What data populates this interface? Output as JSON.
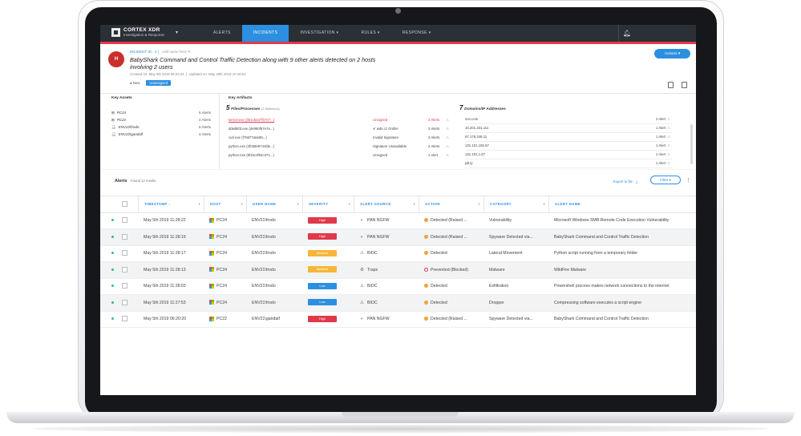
{
  "app": {
    "brand": "CORTEX XDR",
    "brand_sub": "Investigation & Response",
    "nav": [
      "ALERTS",
      "INCIDENTS",
      "INVESTIGATION ▾",
      "RULES ▾",
      "RESPONSE ▾"
    ],
    "active_nav": 1,
    "accent": "#2c8fe0"
  },
  "incident": {
    "avatar_letter": "H",
    "id_label": "INCIDENT ID - 4",
    "alias_placeholder": "Add name here",
    "title": "BabyShark Command and Control Traffic Detection along with 9 other alerts detected on 2 hosts involving 2 users",
    "created": "Created on: May 5th 2019 06:23:34",
    "updated": "Updated on: May 30th 2019 10:18:04",
    "tag_new": "● New",
    "status": "Unassigned",
    "actions_label": "Actions ▾"
  },
  "key_assets": {
    "title": "Key Assets",
    "rows": [
      {
        "icon": "windows-host-icon",
        "name": "PC24",
        "count": "6 Alerts"
      },
      {
        "icon": "windows-host-icon",
        "name": "PC22",
        "count": "4 Alerts"
      },
      {
        "icon": "user-icon",
        "name": "ENV22\\frodo",
        "count": "6 Alerts"
      },
      {
        "icon": "user-icon",
        "name": "ENV22\\gandalf",
        "count": "4 Alerts"
      }
    ]
  },
  "key_artifacts": {
    "title": "Key Artifacts",
    "files_count": "5",
    "files_label": "Files/Processes",
    "files_note": "(2 Malicious)",
    "files": [
      {
        "name": "kernel.exe (0b1c6a47fb707...)",
        "signer": "Unsigned",
        "alerts": "2 Alerts",
        "malicious": true
      },
      {
        "name": "ddwbkfd.exe (de950f67e7e...)",
        "signer": "✔ wds.cz GmbH",
        "alerts": "3 Alerts",
        "malicious": false
      },
      {
        "name": "curl.exe (f78d77a6e85...)",
        "signer": "Invalid Signature",
        "alerts": "2 Alerts",
        "malicious": false
      },
      {
        "name": "python.exe (4f038e9741fde...)",
        "signer": "Signature Unavailable",
        "alerts": "2 Alerts",
        "malicious": false
      },
      {
        "name": "python.exe (9f1bc3f04c371...)",
        "signer": "Unsigned",
        "alerts": "1 Alert",
        "malicious": false
      }
    ],
    "domains_count": "7",
    "domains_label": "Domains/IP Addresses",
    "domains": [
      {
        "name": "cnn.com",
        "alerts": "2 Alert"
      },
      {
        "name": "10.201.231.111",
        "alerts": "1 Alert"
      },
      {
        "name": "67.179.248.11",
        "alerts": "1 Alert"
      },
      {
        "name": "131.101.192.67",
        "alerts": "1 Alert"
      },
      {
        "name": "131.101.1.67",
        "alerts": "1 Alert"
      },
      {
        "name": "jslt.ly",
        "alerts": "1 Alert"
      }
    ]
  },
  "alerts": {
    "title": "Alerts",
    "found": "Found 12 results",
    "export_label": "Export to file",
    "filter_label": "Filter ▾",
    "columns": [
      "TIMESTAMP ↓",
      "HOST",
      "USER NAME",
      "SEVERITY",
      "ALERT SOURCE",
      "ACTION",
      "CATEGORY",
      "ALERT NAME"
    ],
    "rows": [
      {
        "ts": "May 5th 2019 11:28:22",
        "host": "PC24",
        "user": "ENV21\\frodo",
        "sev": "High",
        "src": "PAN NGFW",
        "src_icon": "firewall-icon",
        "action": "Detected (Raised ...",
        "action_icon": "detected-icon",
        "cat": "Vulnerability",
        "name": "Microsoft Windows SMB Remote Code Execution Vulnerability"
      },
      {
        "ts": "May 5th 2019 11:28:19",
        "host": "PC24",
        "user": "ENV21\\frodo",
        "sev": "High",
        "src": "PAN NGFW",
        "src_icon": "firewall-icon",
        "action": "Detected (Raised ...",
        "action_icon": "detected-icon",
        "cat": "Spyware Detected via...",
        "name": "BabyShark Command and Control Traffic Detection"
      },
      {
        "ts": "May 5th 2019 11:28:17",
        "host": "PC24",
        "user": "ENV21\\frodo",
        "sev": "Medium",
        "src": "BIOC",
        "src_icon": "bioc-icon",
        "action": "Detected",
        "action_icon": "detected-icon",
        "cat": "Lateral Movement",
        "name": "Python script running from a temporary folder"
      },
      {
        "ts": "May 5th 2019 11:28:13",
        "host": "PC24",
        "user": "ENV21\\frodo",
        "sev": "Medium",
        "src": "Traps",
        "src_icon": "traps-icon",
        "action": "Prevented (Blocked)",
        "action_icon": "prevented-icon",
        "cat": "Malware",
        "name": "WildFire Malware"
      },
      {
        "ts": "May 5th 2019 11:28:03",
        "host": "PC24",
        "user": "ENV21\\frodo",
        "sev": "Low",
        "src": "BIOC",
        "src_icon": "bioc-icon",
        "action": "Detected",
        "action_icon": "detected-icon",
        "cat": "Exfiltration",
        "name": "Powershell process makes network connections to the internet"
      },
      {
        "ts": "May 5th 2019 11:27:53",
        "host": "PC24",
        "user": "ENV21\\frodo",
        "sev": "Low",
        "src": "BIOC",
        "src_icon": "bioc-icon",
        "action": "Detected",
        "action_icon": "detected-icon",
        "cat": "Dropper",
        "name": "Compressing software executes a script engine"
      },
      {
        "ts": "May 5th 2019 06:20:20",
        "host": "PC22",
        "user": "ENV21\\gandalf",
        "sev": "High",
        "src": "PAN NGFW",
        "src_icon": "firewall-icon",
        "action": "Detected (Raised ...",
        "action_icon": "detected-icon",
        "cat": "Spyware Detected via...",
        "name": "BabyShark Command and Control Traffic Detection"
      }
    ],
    "severity_colors": {
      "High": "#e0394a",
      "Medium": "#f5b63a",
      "Low": "#2c8fe0"
    },
    "action_colors": {
      "detected-icon": "#f0a23a",
      "prevented-icon": "#e0394a"
    }
  }
}
